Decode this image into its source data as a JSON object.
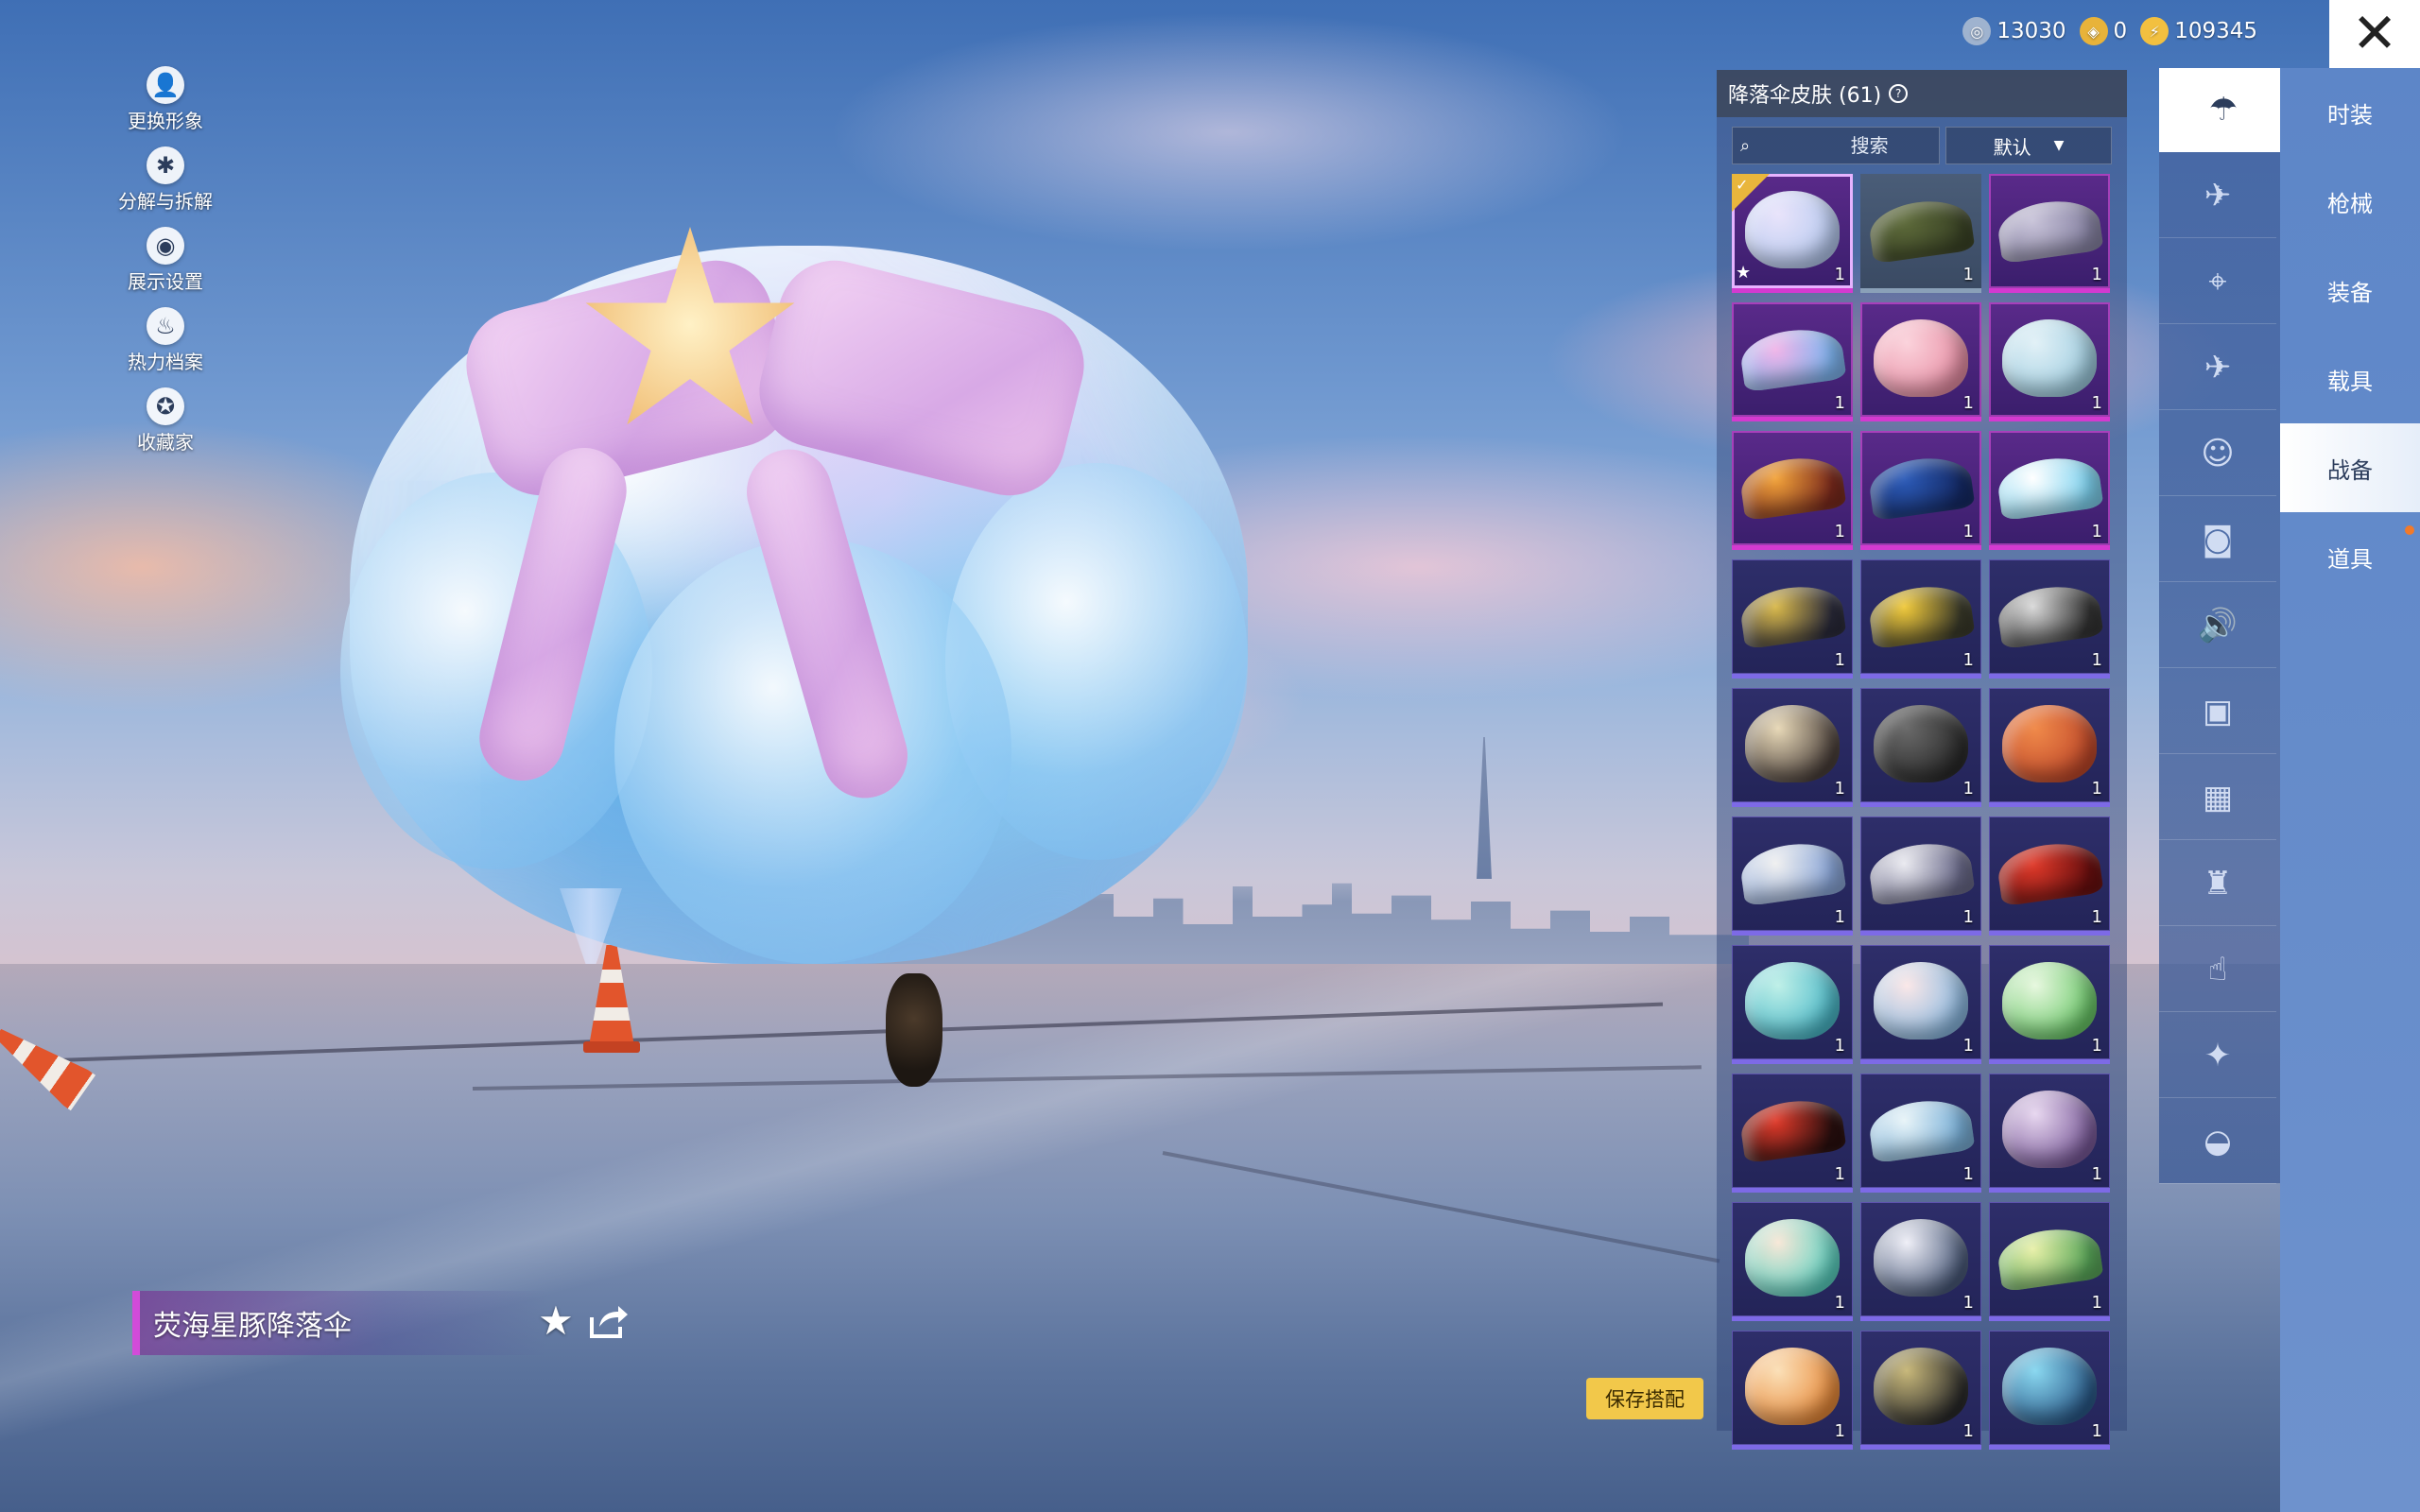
{
  "left_menu": [
    {
      "label": "更换形象",
      "icon": "user-icon"
    },
    {
      "label": "分解与拆解",
      "icon": "puzzle-icon"
    },
    {
      "label": "展示设置",
      "icon": "eye-icon"
    },
    {
      "label": "热力档案",
      "icon": "flame-icon"
    },
    {
      "label": "收藏家",
      "icon": "collector-badge-icon"
    }
  ],
  "currency": [
    {
      "icon": "silver-coin-icon",
      "value": "13030",
      "color": "#9fb3cf"
    },
    {
      "icon": "gold-token-icon",
      "value": "0",
      "color": "#e8b33a"
    },
    {
      "icon": "bolt-coin-icon",
      "value": "109345",
      "color": "#f2c040"
    }
  ],
  "panel": {
    "title": "降落伞皮肤 (61)",
    "search_placeholder": "搜索",
    "sort_label": "默认"
  },
  "items": [
    {
      "rarity": "purple",
      "count": "1",
      "selected": true,
      "favorite": true,
      "colors": [
        "#e9e4fb",
        "#b6c9ef"
      ],
      "shape": "dome"
    },
    {
      "rarity": "gray",
      "count": "1",
      "colors": [
        "#5d6a3a",
        "#3b4426"
      ],
      "shape": "wing"
    },
    {
      "rarity": "purple",
      "count": "1",
      "colors": [
        "#c7c2d8",
        "#8a86a6"
      ],
      "shape": "wing"
    },
    {
      "rarity": "purple",
      "count": "1",
      "colors": [
        "#f0b4e8",
        "#7fb5f0"
      ],
      "shape": "wing"
    },
    {
      "rarity": "purple",
      "count": "1",
      "colors": [
        "#fbd3dc",
        "#e88fa5"
      ],
      "shape": "dome"
    },
    {
      "rarity": "purple",
      "count": "1",
      "colors": [
        "#e2f1f7",
        "#9fcde0"
      ],
      "shape": "dome"
    },
    {
      "rarity": "purple",
      "count": "1",
      "colors": [
        "#f2a33a",
        "#7b2a1d"
      ],
      "shape": "wing"
    },
    {
      "rarity": "purple",
      "count": "1",
      "colors": [
        "#2c5bb8",
        "#152a66"
      ],
      "shape": "wing"
    },
    {
      "rarity": "purple",
      "count": "1",
      "colors": [
        "#ffffff",
        "#7fd3f0"
      ],
      "shape": "wing"
    },
    {
      "rarity": "violet",
      "count": "1",
      "colors": [
        "#d8b84a",
        "#2a2a3a"
      ],
      "shape": "wing"
    },
    {
      "rarity": "violet",
      "count": "1",
      "colors": [
        "#f0c93a",
        "#3a3a2a"
      ],
      "shape": "wing"
    },
    {
      "rarity": "violet",
      "count": "1",
      "colors": [
        "#d9d9d9",
        "#333333"
      ],
      "shape": "wing"
    },
    {
      "rarity": "violet",
      "count": "1",
      "colors": [
        "#e8d9b8",
        "#4a3f3a"
      ],
      "shape": "dome"
    },
    {
      "rarity": "violet",
      "count": "1",
      "colors": [
        "#6a6a6a",
        "#2a2a2a"
      ],
      "shape": "dome"
    },
    {
      "rarity": "violet",
      "count": "1",
      "colors": [
        "#f08a4a",
        "#c0482a"
      ],
      "shape": "dome"
    },
    {
      "rarity": "violet",
      "count": "1",
      "colors": [
        "#f0f0f0",
        "#8aa6d8"
      ],
      "shape": "wing"
    },
    {
      "rarity": "violet",
      "count": "1",
      "colors": [
        "#eaeaf0",
        "#6a6a8a"
      ],
      "shape": "wing"
    },
    {
      "rarity": "violet",
      "count": "1",
      "colors": [
        "#e03a2a",
        "#6a0f0f"
      ],
      "shape": "wing"
    },
    {
      "rarity": "violet",
      "count": "1",
      "colors": [
        "#bff0e8",
        "#4ab8c8"
      ],
      "shape": "dome"
    },
    {
      "rarity": "violet",
      "count": "1",
      "colors": [
        "#fbe8e8",
        "#8ab8e0"
      ],
      "shape": "dome"
    },
    {
      "rarity": "violet",
      "count": "1",
      "colors": [
        "#e8f8e0",
        "#6ac868"
      ],
      "shape": "dome"
    },
    {
      "rarity": "violet",
      "count": "1",
      "colors": [
        "#e03a2a",
        "#2a0f0f"
      ],
      "shape": "wing"
    },
    {
      "rarity": "violet",
      "count": "1",
      "colors": [
        "#e8f4f8",
        "#7ab0d8"
      ],
      "shape": "wing"
    },
    {
      "rarity": "violet",
      "count": "1",
      "colors": [
        "#e8d8f0",
        "#7a5a9a"
      ],
      "shape": "dome"
    },
    {
      "rarity": "violet",
      "count": "1",
      "colors": [
        "#f8e8d8",
        "#5ad0c0"
      ],
      "shape": "dome"
    },
    {
      "rarity": "violet",
      "count": "1",
      "colors": [
        "#f0f0f8",
        "#4a5a7a"
      ],
      "shape": "dome"
    },
    {
      "rarity": "violet",
      "count": "1",
      "colors": [
        "#e8f0a8",
        "#5aa85a"
      ],
      "shape": "wing"
    },
    {
      "rarity": "violet",
      "count": "1",
      "colors": [
        "#fbe0b8",
        "#e88a3a"
      ],
      "shape": "dome"
    },
    {
      "rarity": "violet",
      "count": "1",
      "colors": [
        "#c8b87a",
        "#2a2a2a"
      ],
      "shape": "dome"
    },
    {
      "rarity": "violet",
      "count": "1",
      "colors": [
        "#8ad8f0",
        "#2a5a8a"
      ],
      "shape": "dome"
    }
  ],
  "icon_tabs": [
    {
      "icon": "parachute-icon",
      "active": true
    },
    {
      "icon": "glider-icon"
    },
    {
      "icon": "drone-icon"
    },
    {
      "icon": "plane-icon"
    },
    {
      "icon": "emote-face-icon"
    },
    {
      "icon": "robot-icon"
    },
    {
      "icon": "speaker-icon"
    },
    {
      "icon": "chat-bubble-icon"
    },
    {
      "icon": "gallery-icon"
    },
    {
      "icon": "spray-icon"
    },
    {
      "icon": "tap-effect-icon"
    },
    {
      "icon": "magic-wand-icon"
    },
    {
      "icon": "pan-icon"
    }
  ],
  "categories": [
    {
      "label": "时装"
    },
    {
      "label": "枪械"
    },
    {
      "label": "装备"
    },
    {
      "label": "载具"
    },
    {
      "label": "战备",
      "active": true
    },
    {
      "label": "道具"
    }
  ],
  "item_name": "荧海星豚降落伞",
  "save_label": "保存搭配",
  "colors": {
    "accent_purple": "#d33ad0",
    "save_yellow": "#f2c84a"
  }
}
